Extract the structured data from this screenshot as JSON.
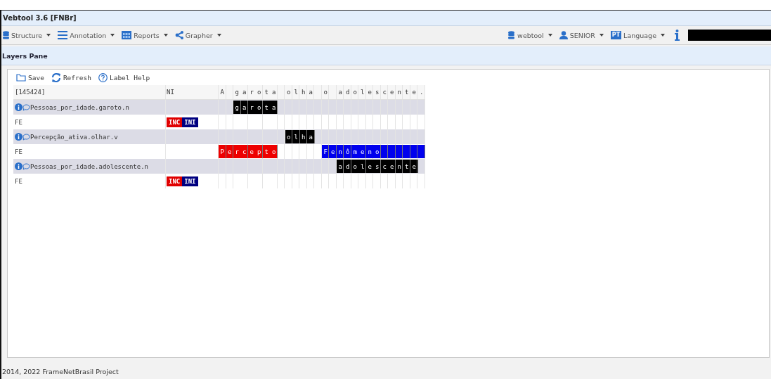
{
  "window": {
    "title": "Vebtool 3.6 [FNBr]"
  },
  "menu": [
    {
      "label": "Structure",
      "kind": "database"
    },
    {
      "label": "Annotation",
      "kind": "list"
    },
    {
      "label": "Reports",
      "kind": "table"
    },
    {
      "label": "Grapher",
      "kind": "share"
    }
  ],
  "user_menu": [
    {
      "label": "webtool",
      "kind": "database"
    },
    {
      "label": "SENIOR",
      "kind": "user"
    },
    {
      "label": "Language",
      "kind": "flag",
      "badge": "PT"
    }
  ],
  "pane": {
    "title": "Layers Pane"
  },
  "toolbar": [
    {
      "label": "Save",
      "kind": "folder"
    },
    {
      "label": "Refresh",
      "kind": "refresh"
    },
    {
      "label": "Label Help",
      "kind": "help"
    }
  ],
  "grid": {
    "sentence_id": "[145424]",
    "ni_header": "NI",
    "sentence": "A garota olha o adolescente.",
    "rows": [
      {
        "kind": "lu",
        "label": "Pessoas_por_idade.garoto.n",
        "tags": [],
        "segments": [
          {
            "kind": "blank"
          },
          {
            "kind": "blank"
          },
          {
            "kind": "span",
            "text": "garota",
            "color": "#000000"
          }
        ]
      },
      {
        "kind": "fe",
        "label": "FE",
        "tags": [
          {
            "text": "INC",
            "color": "#e00000"
          },
          {
            "text": "INI",
            "color": "#000080"
          }
        ],
        "segments": []
      },
      {
        "kind": "lu",
        "label": "Percepção_ativa.olhar.v",
        "tags": [],
        "segments": [
          {
            "kind": "blank"
          },
          {
            "kind": "blank"
          },
          {
            "kind": "blank"
          },
          {
            "kind": "blank"
          },
          {
            "kind": "blank"
          },
          {
            "kind": "blank"
          },
          {
            "kind": "blank"
          },
          {
            "kind": "blank"
          },
          {
            "kind": "blank"
          },
          {
            "kind": "span",
            "text": "olha",
            "color": "#000000"
          }
        ]
      },
      {
        "kind": "fe",
        "label": "FE",
        "tags": [],
        "segments": [
          {
            "kind": "span",
            "text": "Percepto",
            "color": "#ee0000"
          },
          {
            "kind": "blank"
          },
          {
            "kind": "blank"
          },
          {
            "kind": "blank"
          },
          {
            "kind": "blank"
          },
          {
            "kind": "blank"
          },
          {
            "kind": "blank"
          },
          {
            "kind": "span",
            "text": "Fenômeno",
            "color": "#0000ee"
          },
          {
            "kind": "fill"
          },
          {
            "kind": "fill"
          },
          {
            "kind": "fill"
          },
          {
            "kind": "fill"
          },
          {
            "kind": "fill"
          },
          {
            "kind": "fill"
          }
        ]
      },
      {
        "kind": "lu",
        "label": "Pessoas_por_idade.adolescente.n",
        "tags": [],
        "segments": [
          {
            "kind": "blank"
          },
          {
            "kind": "blank"
          },
          {
            "kind": "blank"
          },
          {
            "kind": "blank"
          },
          {
            "kind": "blank"
          },
          {
            "kind": "blank"
          },
          {
            "kind": "blank"
          },
          {
            "kind": "blank"
          },
          {
            "kind": "blank"
          },
          {
            "kind": "blank"
          },
          {
            "kind": "blank"
          },
          {
            "kind": "blank"
          },
          {
            "kind": "blank"
          },
          {
            "kind": "blank"
          },
          {
            "kind": "blank"
          },
          {
            "kind": "blank"
          },
          {
            "kind": "span",
            "text": "adolescente",
            "color": "#000000"
          }
        ]
      },
      {
        "kind": "fe",
        "label": "FE",
        "tags": [
          {
            "text": "INC",
            "color": "#e00000"
          },
          {
            "text": "INI",
            "color": "#000080"
          }
        ],
        "segments": []
      }
    ]
  },
  "footer": "2014, 2022 FrameNetBrasil Project"
}
